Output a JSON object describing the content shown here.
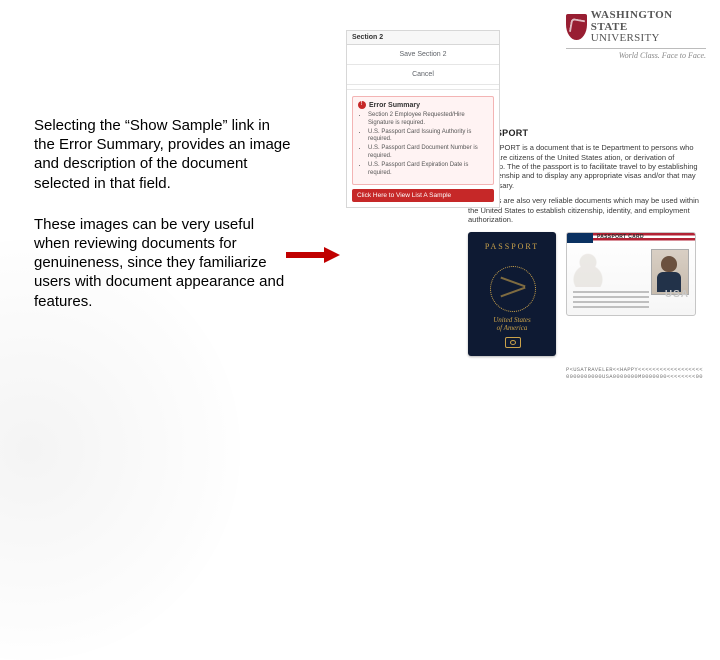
{
  "logo": {
    "line1": "WASHINGTON STATE",
    "line2": "UNIVERSITY",
    "tagline": "World Class. Face to Face."
  },
  "explain": {
    "p1": "Selecting the “Show Sample” link in the Error Summary, provides an image and description of the document selected in that field.",
    "p2": "These images can be very useful when reviewing documents for genuineness, since they familiarize users with document appearance and features."
  },
  "panel": {
    "section_label": "Section 2",
    "save_label": "Save Section 2",
    "cancel_label": "Cancel",
    "error_title": "Error Summary",
    "errors": [
      "Section 2 Employee Requested/Hire Signature is required.",
      "U.S. Passport Card Issuing Authority is required.",
      "U.S. Passport Card Document Number is required.",
      "U.S. Passport Card Expiration Date is required."
    ],
    "view_sample": "Click Here to View List A Sample"
  },
  "sheet": {
    "title": "S PASSPORT",
    "p1": "ES PASSPORT is a document that is te Department to persons who have ey are citizens of the United States ation, or derivation of citizenship. The of the passport is to facilitate travel to by establishing U.S. citizenship and to display any appropriate visas and/or that may be necessary.",
    "p2": "Passports are also very reliable documents which may be used within the United States to establish citizenship, identity, and employment authorization.",
    "booklet_title": "PASSPORT",
    "booklet_country1": "United States",
    "booklet_country2": "of America",
    "card_header": "PASSPORT CARD",
    "card_usa": "USA",
    "mrz1": "P<USATRAVELER<<HAPPY<<<<<<<<<<<<<<<<<<",
    "mrz2": "0000000000USA0000000M0000000<<<<<<<<00"
  }
}
